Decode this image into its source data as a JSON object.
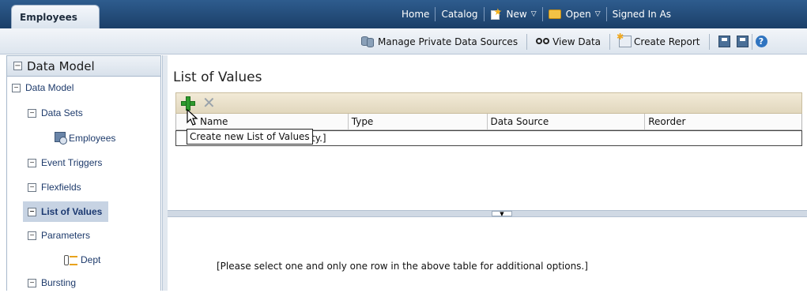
{
  "header": {
    "doc_tab": "Employees",
    "links": {
      "home": "Home",
      "catalog": "Catalog",
      "new": "New",
      "open": "Open",
      "signed_in": "Signed In As"
    }
  },
  "toolbar": {
    "manage_sources": "Manage Private Data Sources",
    "view_data": "View Data",
    "create_report": "Create Report"
  },
  "sidebar": {
    "header": "Data Model",
    "items": [
      {
        "label": "Data Model"
      },
      {
        "label": "Data Sets"
      },
      {
        "label": "Employees"
      },
      {
        "label": "Event Triggers"
      },
      {
        "label": "Flexfields"
      },
      {
        "label": "List of Values"
      },
      {
        "label": "Parameters"
      },
      {
        "label": "Dept"
      },
      {
        "label": "Bursting"
      }
    ]
  },
  "main": {
    "title": "List of Values",
    "columns": [
      "Name",
      "Type",
      "Data Source",
      "Reorder"
    ],
    "empty_text_visible": "ty.]",
    "tooltip": "Create new List of Values",
    "hint": "[Please select one and only one row in the above table for additional options.]"
  },
  "icons": {
    "expand_box": "minus-box-icon",
    "add": "add-icon",
    "delete": "delete-icon",
    "new": "new-icon",
    "open": "folder-icon",
    "save": "save-icon",
    "help": "help-icon"
  },
  "colors": {
    "header_bg": "#1b3f68",
    "selected_item_bg": "#c7d3e3",
    "table_toolbar_bg": "#e8dfc8",
    "add_green": "#2e9b2e"
  }
}
